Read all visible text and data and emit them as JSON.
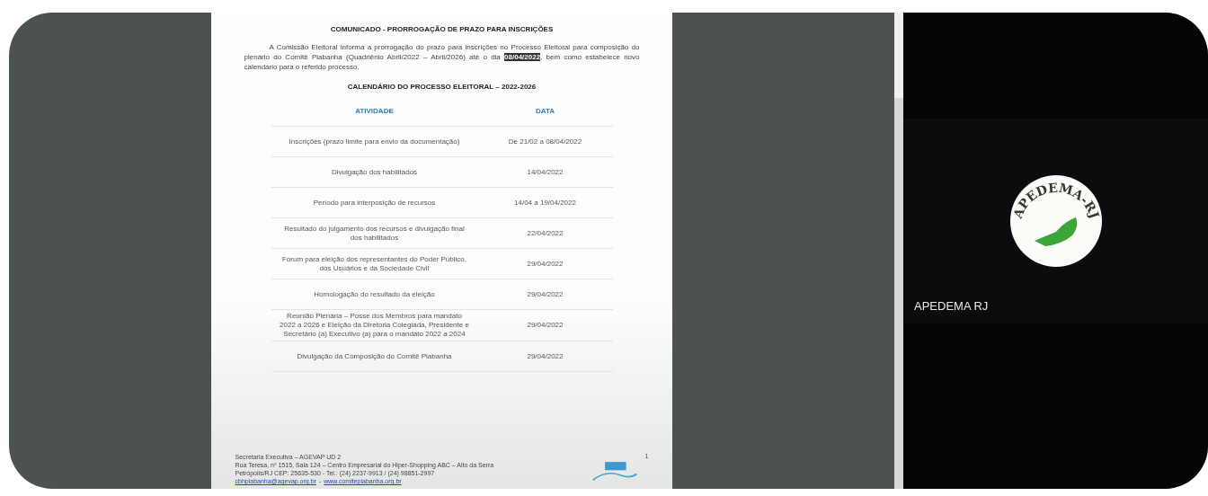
{
  "document": {
    "title": "COMUNICADO - PRORROGAÇÃO DE PRAZO PARA INSCRIÇÕES",
    "paragraph": "A Comissão Eleitoral informa a prorrogação do prazo para inscrições no Processo Eleitoral para composição do plenário do Comitê Piabanha (Quadriênio Abril/2022 – Abril/2026) até o dia **08/04/2022**, bem como estabelece novo calendário para o referido processo.",
    "calendar_title": "CALENDÁRIO DO PROCESSO ELEITORAL – 2022-2026",
    "table": {
      "columns": [
        "ATIVIDADE",
        "DATA"
      ],
      "rows": [
        [
          "Inscrições (prazo limite para envio da documentação)",
          "De 21/02 a 08/04/2022"
        ],
        [
          "Divulgação dos habilitados",
          "14/04/2022"
        ],
        [
          "Período para interposição de recursos",
          "14/04 a 19/04/2022"
        ],
        [
          "Resultado do julgamento dos recursos e divulgação final dos habilitados",
          "22/04/2022"
        ],
        [
          "Fórum para eleição dos representantes do Poder Público, dos Usuários e da Sociedade Civil",
          "29/04/2022"
        ],
        [
          "Homologação do resultado da eleição",
          "29/04/2022"
        ],
        [
          "Reunião Plenária – Posse dos Membros para mandato 2022 a 2026 e Eleição da Diretoria Colegiada, Presidente e Secretário (a) Executivo (a) para o mandato 2022 a 2024",
          "29/04/2022"
        ],
        [
          "Divulgação da Composição do Comitê Piabanha",
          "29/04/2022"
        ]
      ]
    },
    "footer_lines": [
      "Secretaria Executiva – AGEVAP UD 2",
      "Rua Teresa, nº 1515, Sala 124 – Centro Empresarial do Hiper-Shopping ABC – Alto da Serra",
      "Petrópolis/RJ CEP: 25635-530 - Tel.: (24) 2237-9913 / (24) 98851-2997"
    ],
    "footer_links": [
      "cbhpiabanha@agevap.org.br",
      "www.comitepiabanha.org.br"
    ],
    "footer_separator": "-",
    "page_number": "1"
  },
  "participant": {
    "name": "APEDEMA RJ",
    "logo_text": "APEDEMA-RJ"
  }
}
